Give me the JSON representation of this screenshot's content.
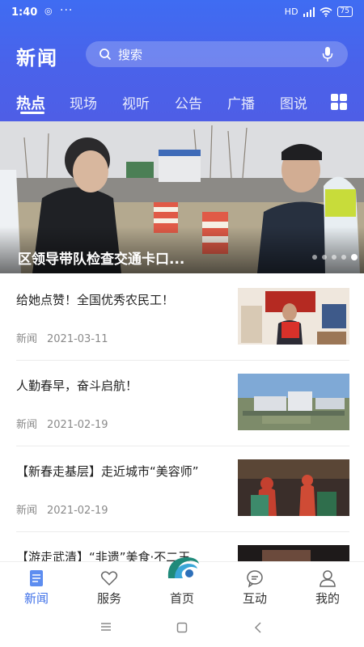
{
  "status": {
    "time": "1:40",
    "network": "HD",
    "battery": "75"
  },
  "header": {
    "title": "新闻"
  },
  "search": {
    "placeholder": "搜索"
  },
  "tabs": [
    {
      "label": "热点"
    },
    {
      "label": "现场"
    },
    {
      "label": "视听"
    },
    {
      "label": "公告"
    },
    {
      "label": "广播"
    },
    {
      "label": "图说"
    }
  ],
  "banner": {
    "caption": "区领导带队检查交通卡口...",
    "slide_count": 5,
    "active_slide": 5
  },
  "news": [
    {
      "title": "给她点赞！全国优秀农民工！",
      "source": "新闻",
      "date": "2021-03-11"
    },
    {
      "title": "人勤春早，奋斗启航！",
      "source": "新闻",
      "date": "2021-02-19"
    },
    {
      "title": "【新春走基层】走近城市“美容师”",
      "source": "新闻",
      "date": "2021-02-19"
    },
    {
      "title": "【游走武清】“非遗”美食·不二王",
      "source": "",
      "date": ""
    }
  ],
  "bottom_nav": [
    {
      "label": "新闻",
      "icon": "news-icon",
      "active": true
    },
    {
      "label": "服务",
      "icon": "heart-icon"
    },
    {
      "label": "首页",
      "icon": "home-logo-icon"
    },
    {
      "label": "互动",
      "icon": "chat-icon"
    },
    {
      "label": "我的",
      "icon": "user-icon"
    }
  ],
  "colors": {
    "accent": "#3d6fe8",
    "header_start": "#3f6cf2",
    "header_end": "#4e5ee6"
  }
}
